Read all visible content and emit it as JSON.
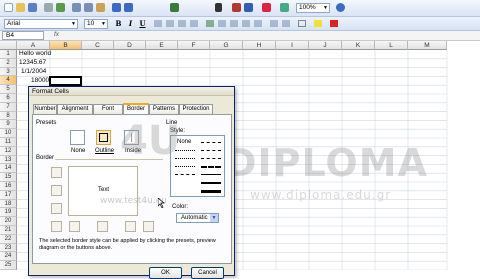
{
  "toolbar": {
    "zoom": "100%"
  },
  "formatting": {
    "font_name": "Arial",
    "font_size": "10",
    "bold": "B",
    "italic": "I",
    "underline": "U"
  },
  "formula_bar": {
    "name_box": "B4",
    "fx": "fx"
  },
  "columns": [
    "A",
    "B",
    "C",
    "D",
    "E",
    "F",
    "G",
    "H",
    "I",
    "J",
    "K",
    "L",
    "M"
  ],
  "rows": [
    "1",
    "2",
    "3",
    "4",
    "5",
    "6",
    "7",
    "8",
    "9",
    "10",
    "11",
    "12",
    "13",
    "14",
    "15",
    "16",
    "17",
    "18",
    "19",
    "20",
    "21",
    "22",
    "23",
    "24",
    "25"
  ],
  "cells": {
    "a1": "Hello world",
    "a2": "12345.67",
    "a3": "1/1/2004",
    "a4": "18000"
  },
  "watermark": {
    "brand": "DIPLOMA",
    "site1": "www.test4u.eu",
    "site2": "www.diploma.edu.gr",
    "logo": "4U"
  },
  "dialog": {
    "title": "Format Cells",
    "tabs": [
      "Number",
      "Alignment",
      "Font",
      "Border",
      "Patterns",
      "Protection"
    ],
    "active_tab": "Border",
    "presets_label": "Presets",
    "preset_none": "None",
    "preset_outline": "Outline",
    "preset_inside": "Inside",
    "border_label": "Border",
    "preview_text": "Text",
    "line_label": "Line",
    "style_label": "Style:",
    "style_none": "None",
    "color_label": "Color:",
    "color_value": "Automatic",
    "help": "The selected border style can be applied by clicking the presets, preview diagram or the buttons above.",
    "ok": "OK",
    "cancel": "Cancel"
  }
}
